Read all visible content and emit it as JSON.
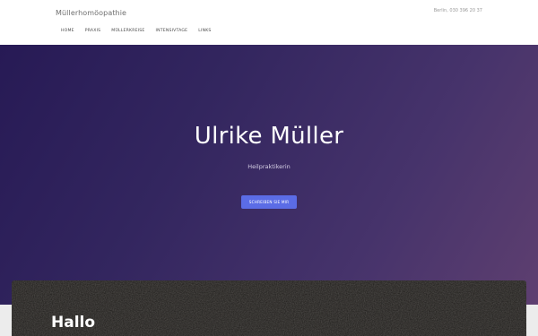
{
  "header": {
    "brand": "Müllerhomöopathie",
    "contact": "Berlin, 030 396 20 37",
    "nav": [
      {
        "label": "HOME"
      },
      {
        "label": "PRAXIS"
      },
      {
        "label": "MÜLLERKREISE"
      },
      {
        "label": "INTENSIVTAGE"
      },
      {
        "label": "LINKS"
      }
    ]
  },
  "hero": {
    "title": "Ulrike Müller",
    "subtitle": "Heilpraktikerin",
    "cta_label": "SCHREIBEN SIE MIR"
  },
  "section": {
    "title": "Hallo"
  },
  "colors": {
    "hero_start": "#271a55",
    "hero_end": "#5e3f70",
    "button": "#5b6ce6"
  }
}
